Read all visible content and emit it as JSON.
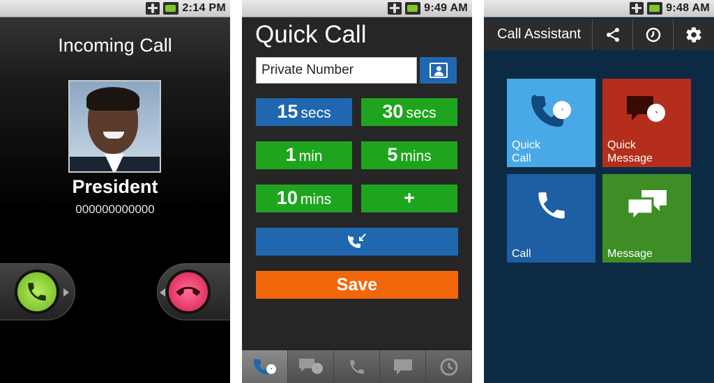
{
  "screens": {
    "incoming": {
      "status_time": "2:14 PM",
      "title": "Incoming Call",
      "caller_name": "President",
      "caller_number": "000000000000"
    },
    "quick_call": {
      "status_time": "9:49 AM",
      "title": "Quick Call",
      "number_input_value": "Private Number",
      "timers": [
        {
          "num": "15",
          "unit": "secs"
        },
        {
          "num": "30",
          "unit": "secs"
        },
        {
          "num": "1",
          "unit": "min"
        },
        {
          "num": "5",
          "unit": "mins"
        },
        {
          "num": "10",
          "unit": "mins"
        },
        {
          "num": "+",
          "unit": ""
        }
      ],
      "save_label": "Save"
    },
    "call_assistant": {
      "status_time": "9:48 AM",
      "title": "Call Assistant",
      "tiles": {
        "quick_call": "Quick\nCall",
        "quick_message": "Quick\nMessage",
        "call": "Call",
        "message": "Message"
      }
    }
  },
  "colors": {
    "blue": "#1f68b0",
    "green": "#1fa51d",
    "orange": "#f2670a",
    "tile_light_blue": "#49a9e6",
    "tile_red": "#b52e1c",
    "tile_blue": "#1e5ea3",
    "tile_green": "#3e8e25",
    "assistant_bg": "#0d2a44"
  }
}
